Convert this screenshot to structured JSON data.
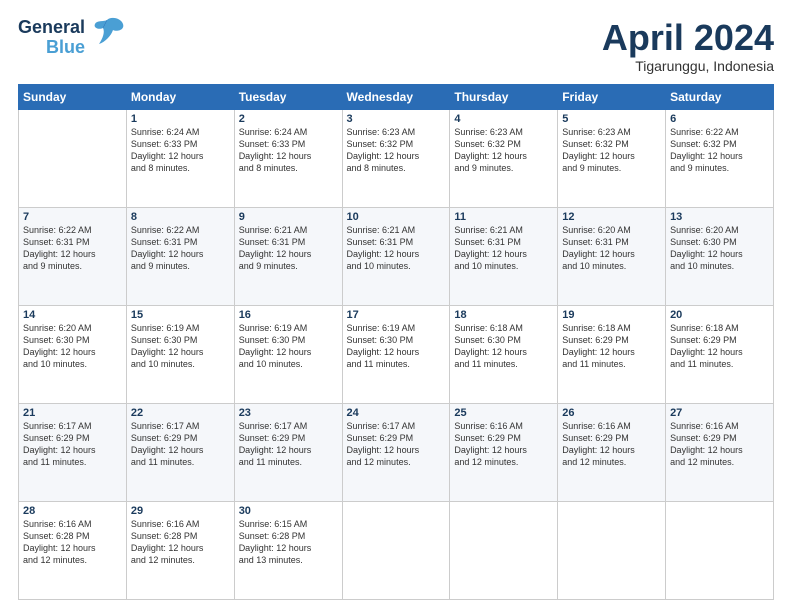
{
  "logo": {
    "line1": "General",
    "line2": "Blue"
  },
  "header": {
    "month": "April 2024",
    "location": "Tigarunggu, Indonesia"
  },
  "weekdays": [
    "Sunday",
    "Monday",
    "Tuesday",
    "Wednesday",
    "Thursday",
    "Friday",
    "Saturday"
  ],
  "weeks": [
    [
      {
        "day": "",
        "text": ""
      },
      {
        "day": "1",
        "text": "Sunrise: 6:24 AM\nSunset: 6:33 PM\nDaylight: 12 hours\nand 8 minutes."
      },
      {
        "day": "2",
        "text": "Sunrise: 6:24 AM\nSunset: 6:33 PM\nDaylight: 12 hours\nand 8 minutes."
      },
      {
        "day": "3",
        "text": "Sunrise: 6:23 AM\nSunset: 6:32 PM\nDaylight: 12 hours\nand 8 minutes."
      },
      {
        "day": "4",
        "text": "Sunrise: 6:23 AM\nSunset: 6:32 PM\nDaylight: 12 hours\nand 9 minutes."
      },
      {
        "day": "5",
        "text": "Sunrise: 6:23 AM\nSunset: 6:32 PM\nDaylight: 12 hours\nand 9 minutes."
      },
      {
        "day": "6",
        "text": "Sunrise: 6:22 AM\nSunset: 6:32 PM\nDaylight: 12 hours\nand 9 minutes."
      }
    ],
    [
      {
        "day": "7",
        "text": "Sunrise: 6:22 AM\nSunset: 6:31 PM\nDaylight: 12 hours\nand 9 minutes."
      },
      {
        "day": "8",
        "text": "Sunrise: 6:22 AM\nSunset: 6:31 PM\nDaylight: 12 hours\nand 9 minutes."
      },
      {
        "day": "9",
        "text": "Sunrise: 6:21 AM\nSunset: 6:31 PM\nDaylight: 12 hours\nand 9 minutes."
      },
      {
        "day": "10",
        "text": "Sunrise: 6:21 AM\nSunset: 6:31 PM\nDaylight: 12 hours\nand 10 minutes."
      },
      {
        "day": "11",
        "text": "Sunrise: 6:21 AM\nSunset: 6:31 PM\nDaylight: 12 hours\nand 10 minutes."
      },
      {
        "day": "12",
        "text": "Sunrise: 6:20 AM\nSunset: 6:31 PM\nDaylight: 12 hours\nand 10 minutes."
      },
      {
        "day": "13",
        "text": "Sunrise: 6:20 AM\nSunset: 6:30 PM\nDaylight: 12 hours\nand 10 minutes."
      }
    ],
    [
      {
        "day": "14",
        "text": "Sunrise: 6:20 AM\nSunset: 6:30 PM\nDaylight: 12 hours\nand 10 minutes."
      },
      {
        "day": "15",
        "text": "Sunrise: 6:19 AM\nSunset: 6:30 PM\nDaylight: 12 hours\nand 10 minutes."
      },
      {
        "day": "16",
        "text": "Sunrise: 6:19 AM\nSunset: 6:30 PM\nDaylight: 12 hours\nand 10 minutes."
      },
      {
        "day": "17",
        "text": "Sunrise: 6:19 AM\nSunset: 6:30 PM\nDaylight: 12 hours\nand 11 minutes."
      },
      {
        "day": "18",
        "text": "Sunrise: 6:18 AM\nSunset: 6:30 PM\nDaylight: 12 hours\nand 11 minutes."
      },
      {
        "day": "19",
        "text": "Sunrise: 6:18 AM\nSunset: 6:29 PM\nDaylight: 12 hours\nand 11 minutes."
      },
      {
        "day": "20",
        "text": "Sunrise: 6:18 AM\nSunset: 6:29 PM\nDaylight: 12 hours\nand 11 minutes."
      }
    ],
    [
      {
        "day": "21",
        "text": "Sunrise: 6:17 AM\nSunset: 6:29 PM\nDaylight: 12 hours\nand 11 minutes."
      },
      {
        "day": "22",
        "text": "Sunrise: 6:17 AM\nSunset: 6:29 PM\nDaylight: 12 hours\nand 11 minutes."
      },
      {
        "day": "23",
        "text": "Sunrise: 6:17 AM\nSunset: 6:29 PM\nDaylight: 12 hours\nand 11 minutes."
      },
      {
        "day": "24",
        "text": "Sunrise: 6:17 AM\nSunset: 6:29 PM\nDaylight: 12 hours\nand 12 minutes."
      },
      {
        "day": "25",
        "text": "Sunrise: 6:16 AM\nSunset: 6:29 PM\nDaylight: 12 hours\nand 12 minutes."
      },
      {
        "day": "26",
        "text": "Sunrise: 6:16 AM\nSunset: 6:29 PM\nDaylight: 12 hours\nand 12 minutes."
      },
      {
        "day": "27",
        "text": "Sunrise: 6:16 AM\nSunset: 6:29 PM\nDaylight: 12 hours\nand 12 minutes."
      }
    ],
    [
      {
        "day": "28",
        "text": "Sunrise: 6:16 AM\nSunset: 6:28 PM\nDaylight: 12 hours\nand 12 minutes."
      },
      {
        "day": "29",
        "text": "Sunrise: 6:16 AM\nSunset: 6:28 PM\nDaylight: 12 hours\nand 12 minutes."
      },
      {
        "day": "30",
        "text": "Sunrise: 6:15 AM\nSunset: 6:28 PM\nDaylight: 12 hours\nand 13 minutes."
      },
      {
        "day": "",
        "text": ""
      },
      {
        "day": "",
        "text": ""
      },
      {
        "day": "",
        "text": ""
      },
      {
        "day": "",
        "text": ""
      }
    ]
  ]
}
